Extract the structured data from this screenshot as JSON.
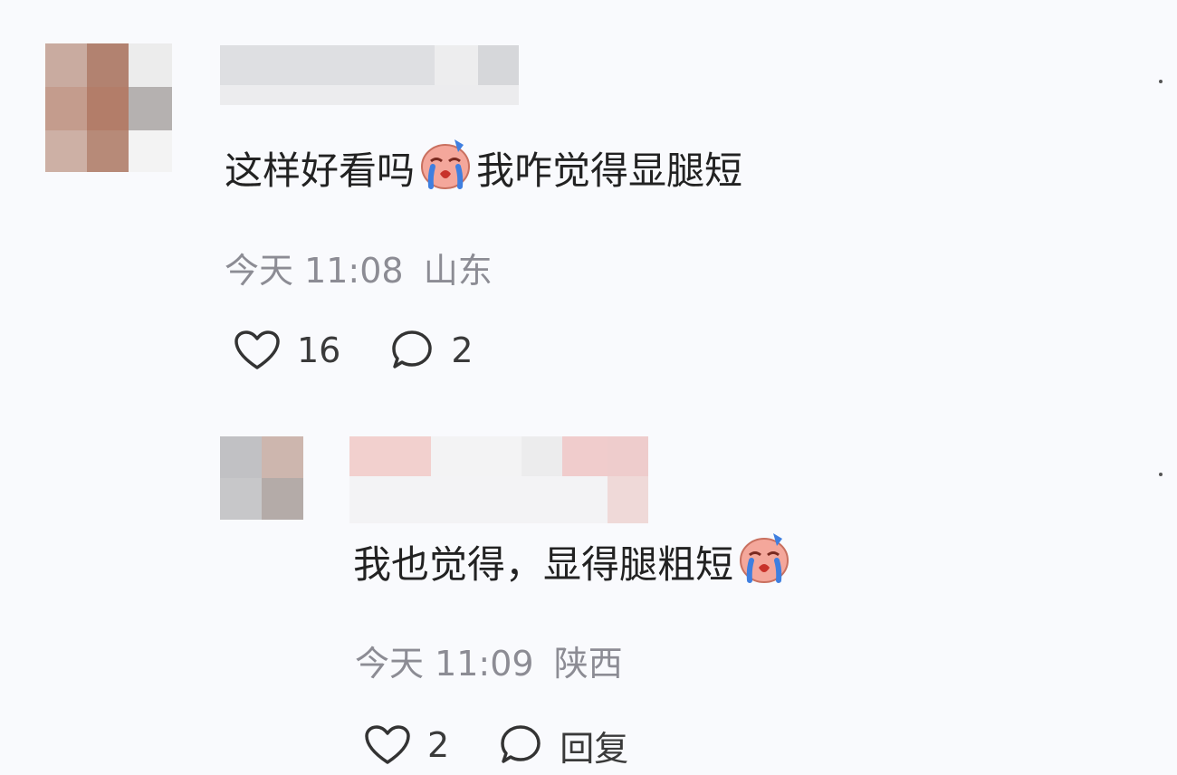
{
  "comments": [
    {
      "text_before": "这样好看吗",
      "emoji": "crying-face-emoji",
      "text_after": "我咋觉得显腿短",
      "time": "今天 11:08",
      "location": "山东",
      "likes": "16",
      "replies": "2"
    },
    {
      "text_before": "我也觉得，显得腿粗短",
      "emoji": "crying-face-emoji",
      "time": "今天 11:09",
      "location": "陕西",
      "likes": "2",
      "reply_label": "回复"
    }
  ],
  "icons": {
    "like": "heart-outline-icon",
    "comment": "speech-bubble-icon",
    "more": "more-dots-icon"
  },
  "colors": {
    "background": "#f9fafd",
    "text": "#222222",
    "meta": "#8c8c94",
    "emoji_face": "#f4a79b",
    "emoji_tear": "#3f7fe0"
  }
}
